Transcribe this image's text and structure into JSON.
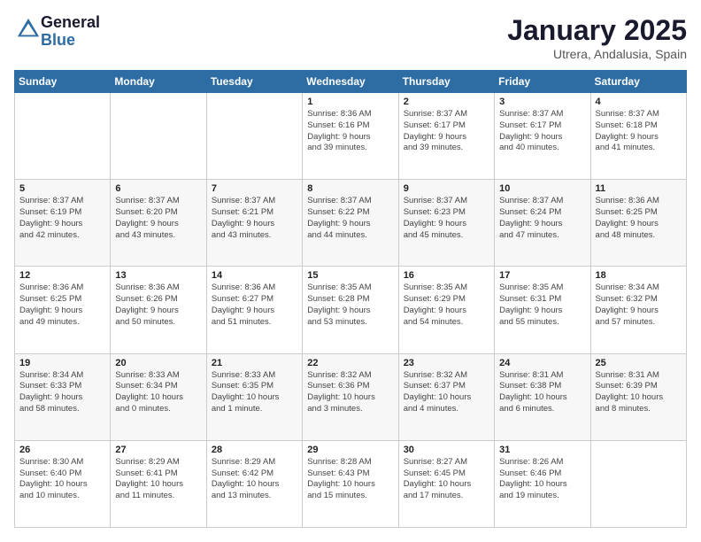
{
  "logo": {
    "line1": "General",
    "line2": "Blue"
  },
  "header": {
    "title": "January 2025",
    "subtitle": "Utrera, Andalusia, Spain"
  },
  "days_of_week": [
    "Sunday",
    "Monday",
    "Tuesday",
    "Wednesday",
    "Thursday",
    "Friday",
    "Saturday"
  ],
  "weeks": [
    [
      {
        "day": "",
        "info": ""
      },
      {
        "day": "",
        "info": ""
      },
      {
        "day": "",
        "info": ""
      },
      {
        "day": "1",
        "info": "Sunrise: 8:36 AM\nSunset: 6:16 PM\nDaylight: 9 hours\nand 39 minutes."
      },
      {
        "day": "2",
        "info": "Sunrise: 8:37 AM\nSunset: 6:17 PM\nDaylight: 9 hours\nand 39 minutes."
      },
      {
        "day": "3",
        "info": "Sunrise: 8:37 AM\nSunset: 6:17 PM\nDaylight: 9 hours\nand 40 minutes."
      },
      {
        "day": "4",
        "info": "Sunrise: 8:37 AM\nSunset: 6:18 PM\nDaylight: 9 hours\nand 41 minutes."
      }
    ],
    [
      {
        "day": "5",
        "info": "Sunrise: 8:37 AM\nSunset: 6:19 PM\nDaylight: 9 hours\nand 42 minutes."
      },
      {
        "day": "6",
        "info": "Sunrise: 8:37 AM\nSunset: 6:20 PM\nDaylight: 9 hours\nand 43 minutes."
      },
      {
        "day": "7",
        "info": "Sunrise: 8:37 AM\nSunset: 6:21 PM\nDaylight: 9 hours\nand 43 minutes."
      },
      {
        "day": "8",
        "info": "Sunrise: 8:37 AM\nSunset: 6:22 PM\nDaylight: 9 hours\nand 44 minutes."
      },
      {
        "day": "9",
        "info": "Sunrise: 8:37 AM\nSunset: 6:23 PM\nDaylight: 9 hours\nand 45 minutes."
      },
      {
        "day": "10",
        "info": "Sunrise: 8:37 AM\nSunset: 6:24 PM\nDaylight: 9 hours\nand 47 minutes."
      },
      {
        "day": "11",
        "info": "Sunrise: 8:36 AM\nSunset: 6:25 PM\nDaylight: 9 hours\nand 48 minutes."
      }
    ],
    [
      {
        "day": "12",
        "info": "Sunrise: 8:36 AM\nSunset: 6:25 PM\nDaylight: 9 hours\nand 49 minutes."
      },
      {
        "day": "13",
        "info": "Sunrise: 8:36 AM\nSunset: 6:26 PM\nDaylight: 9 hours\nand 50 minutes."
      },
      {
        "day": "14",
        "info": "Sunrise: 8:36 AM\nSunset: 6:27 PM\nDaylight: 9 hours\nand 51 minutes."
      },
      {
        "day": "15",
        "info": "Sunrise: 8:35 AM\nSunset: 6:28 PM\nDaylight: 9 hours\nand 53 minutes."
      },
      {
        "day": "16",
        "info": "Sunrise: 8:35 AM\nSunset: 6:29 PM\nDaylight: 9 hours\nand 54 minutes."
      },
      {
        "day": "17",
        "info": "Sunrise: 8:35 AM\nSunset: 6:31 PM\nDaylight: 9 hours\nand 55 minutes."
      },
      {
        "day": "18",
        "info": "Sunrise: 8:34 AM\nSunset: 6:32 PM\nDaylight: 9 hours\nand 57 minutes."
      }
    ],
    [
      {
        "day": "19",
        "info": "Sunrise: 8:34 AM\nSunset: 6:33 PM\nDaylight: 9 hours\nand 58 minutes."
      },
      {
        "day": "20",
        "info": "Sunrise: 8:33 AM\nSunset: 6:34 PM\nDaylight: 10 hours\nand 0 minutes."
      },
      {
        "day": "21",
        "info": "Sunrise: 8:33 AM\nSunset: 6:35 PM\nDaylight: 10 hours\nand 1 minute."
      },
      {
        "day": "22",
        "info": "Sunrise: 8:32 AM\nSunset: 6:36 PM\nDaylight: 10 hours\nand 3 minutes."
      },
      {
        "day": "23",
        "info": "Sunrise: 8:32 AM\nSunset: 6:37 PM\nDaylight: 10 hours\nand 4 minutes."
      },
      {
        "day": "24",
        "info": "Sunrise: 8:31 AM\nSunset: 6:38 PM\nDaylight: 10 hours\nand 6 minutes."
      },
      {
        "day": "25",
        "info": "Sunrise: 8:31 AM\nSunset: 6:39 PM\nDaylight: 10 hours\nand 8 minutes."
      }
    ],
    [
      {
        "day": "26",
        "info": "Sunrise: 8:30 AM\nSunset: 6:40 PM\nDaylight: 10 hours\nand 10 minutes."
      },
      {
        "day": "27",
        "info": "Sunrise: 8:29 AM\nSunset: 6:41 PM\nDaylight: 10 hours\nand 11 minutes."
      },
      {
        "day": "28",
        "info": "Sunrise: 8:29 AM\nSunset: 6:42 PM\nDaylight: 10 hours\nand 13 minutes."
      },
      {
        "day": "29",
        "info": "Sunrise: 8:28 AM\nSunset: 6:43 PM\nDaylight: 10 hours\nand 15 minutes."
      },
      {
        "day": "30",
        "info": "Sunrise: 8:27 AM\nSunset: 6:45 PM\nDaylight: 10 hours\nand 17 minutes."
      },
      {
        "day": "31",
        "info": "Sunrise: 8:26 AM\nSunset: 6:46 PM\nDaylight: 10 hours\nand 19 minutes."
      },
      {
        "day": "",
        "info": ""
      }
    ]
  ]
}
